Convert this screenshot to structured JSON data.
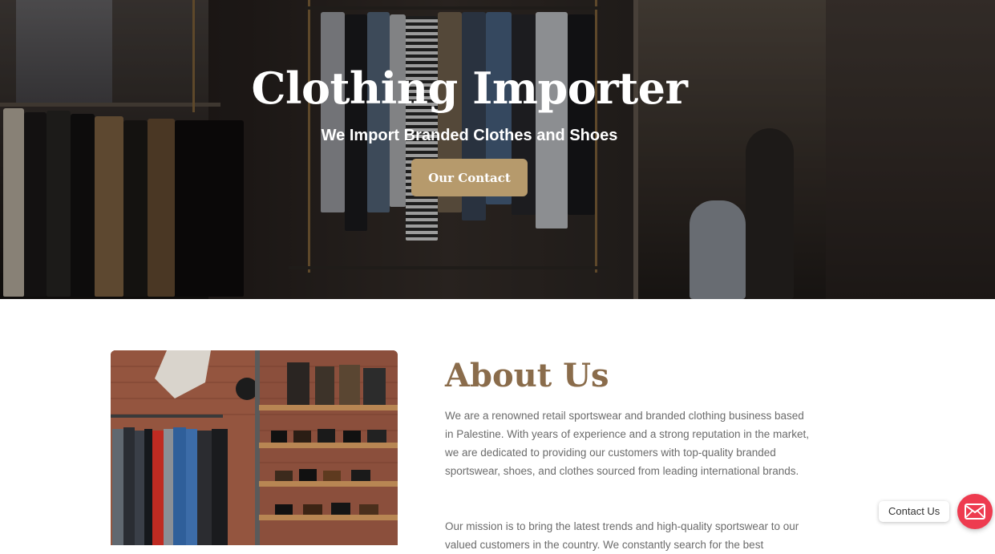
{
  "hero": {
    "title": "Clothing Importer",
    "subtitle": "We Import Branded Clothes and Shoes",
    "cta_label": "Our Contact",
    "accent_color": "#b69a6c"
  },
  "about": {
    "title": "About Us",
    "paragraph_1": "We are a renowned retail sportswear and branded clothing business based in Palestine. With years of experience and a strong reputation in the market, we are dedicated to providing our customers with top-quality branded sportswear, shoes, and clothes sourced from leading international brands.",
    "paragraph_2": "Our mission is to bring the latest trends and high-quality sportswear to our valued customers in the country. We constantly search for the best",
    "title_color": "#8a6c4b",
    "image_icon": "store-interior-photo"
  },
  "contact_widget": {
    "label": "Contact Us",
    "icon": "envelope-icon",
    "color": "#ee3b4f"
  }
}
